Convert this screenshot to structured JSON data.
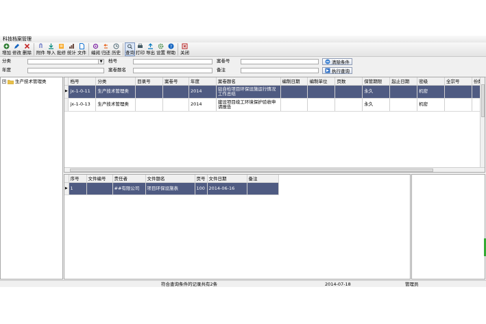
{
  "window": {
    "title": "科技档案管理"
  },
  "toolbar": {
    "groups": [
      [
        {
          "label": "增加",
          "icon": "add-icon",
          "color": "#2e7d32"
        },
        {
          "label": "修改",
          "icon": "edit-icon",
          "color": "#1565c0"
        },
        {
          "label": "删除",
          "icon": "delete-icon",
          "color": "#c62828"
        }
      ],
      [
        {
          "label": "附件",
          "icon": "attachment-icon",
          "color": "#5c6bc0"
        },
        {
          "label": "导入",
          "icon": "import-icon",
          "color": "#00897b"
        },
        {
          "label": "批修",
          "icon": "batch-edit-icon",
          "color": "#f9a825"
        },
        {
          "label": "统计",
          "icon": "statistics-icon",
          "color": "#6d4c41"
        },
        {
          "label": "文件",
          "icon": "file-icon",
          "color": "#1976d2"
        }
      ],
      [
        {
          "label": "编阅",
          "icon": "review-icon",
          "color": "#7b1fa2"
        },
        {
          "label": "归还",
          "icon": "return-icon",
          "color": "#e65100"
        },
        {
          "label": "历史",
          "icon": "history-icon",
          "color": "#546e7a"
        }
      ],
      [
        {
          "label": "查询",
          "icon": "query-icon",
          "color": "#37474f",
          "active": true
        },
        {
          "label": "打印",
          "icon": "print-icon",
          "color": "#455a64"
        },
        {
          "label": "导出",
          "icon": "export-icon",
          "color": "#0277bd"
        },
        {
          "label": "设置",
          "icon": "settings-icon",
          "color": "#2e7d32"
        },
        {
          "label": "帮助",
          "icon": "help-icon",
          "color": "#1565c0"
        }
      ],
      [
        {
          "label": "关闭",
          "icon": "close-icon",
          "color": "#b71c1c"
        }
      ]
    ]
  },
  "filters": {
    "category_label": "分类",
    "archive_no_label": "档号",
    "case_no_label": "案卷号",
    "year_label": "年度",
    "case_title_label": "案卷题名",
    "remark_label": "备注",
    "clear_button": "清除条件",
    "execute_button": "执行查询"
  },
  "tree": {
    "root_label": "生产技术管理类"
  },
  "main_table": {
    "columns": [
      "档号",
      "分类",
      "目录号",
      "案卷号",
      "年度",
      "案卷题名",
      "编制日期",
      "编制单位",
      "页数",
      "保管期限",
      "起止日期",
      "密级",
      "全宗号",
      "份数"
    ],
    "rows": [
      [
        "jx-1-0-11",
        "生产技术管理类",
        "",
        "",
        "2014",
        "驻自检项目环保设施运行情况工作总结",
        "",
        "",
        "",
        "永久",
        "",
        "机密",
        "",
        ""
      ],
      [
        "jx-1-0-13",
        "生产技术管理类",
        "",
        "",
        "2014",
        "建设项目竣工环境保护验收申请报告",
        "",
        "",
        "",
        "永久",
        "",
        "机密",
        "",
        ""
      ]
    ],
    "selected_row": 0
  },
  "detail_table": {
    "columns": [
      "序号",
      "文件编号",
      "责任者",
      "文件题名",
      "页号",
      "文件日期",
      "备注"
    ],
    "rows": [
      [
        "1",
        "",
        "##有限公司",
        "项目环保设施表",
        "100",
        "2014-06-16",
        ""
      ]
    ]
  },
  "status": {
    "message": "符合查询条件的记录共有2条",
    "date": "2014-07-18",
    "user": "管理员"
  },
  "colors": {
    "selection": "#4f5b82",
    "accent_green": "#33aa33"
  }
}
